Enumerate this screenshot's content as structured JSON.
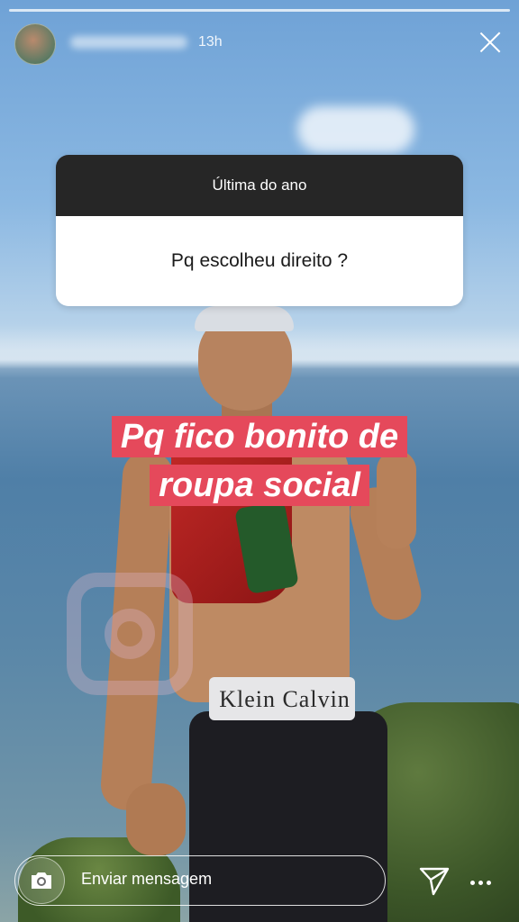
{
  "story": {
    "time_ago": "13h",
    "question_sticker": {
      "title": "Última do ano",
      "question": "Pq escolheu direito ?"
    },
    "answer_lines": [
      "Pq fico bonito de",
      "roupa social"
    ],
    "waistband_text": "Klein   Calvin"
  },
  "footer": {
    "message_placeholder": "Enviar mensagem"
  },
  "colors": {
    "answer_highlight": "#e5495b",
    "sticker_header": "#262626"
  },
  "icons": [
    "close-icon",
    "camera-icon",
    "send-icon",
    "more-icon"
  ]
}
